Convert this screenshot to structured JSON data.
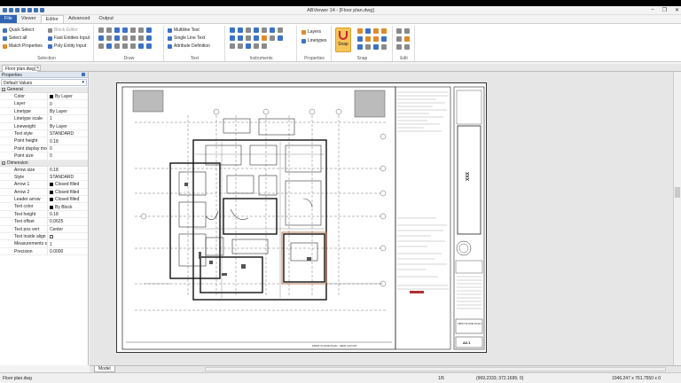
{
  "window": {
    "title": "ABViewer 14 - [Floor plan.dwg]",
    "controls": [
      "–",
      "❐",
      "✕"
    ]
  },
  "tabs": [
    "File",
    "Viewer",
    "Editor",
    "Advanced",
    "Output"
  ],
  "active_tab": "Editor",
  "ribbon": {
    "selection": {
      "label": "Selection",
      "quick_select": "Quick Select",
      "select_all": "Select all",
      "match_properties": "Match Properties",
      "block_editor": "Block Editor",
      "fast_entities_input": "Fast Entities Input",
      "poly_entity_input": "Poly Entity Input"
    },
    "draw": {
      "label": "Draw"
    },
    "text": {
      "label": "Text",
      "multiline_text": "Multiline Text",
      "single_line_text": "Single Line Text",
      "attribute_definition": "Attribute Definition"
    },
    "instruments": {
      "label": "Instruments"
    },
    "properties": {
      "label": "Properties",
      "layers": "Layers",
      "linetypes": "Linetypes"
    },
    "snap": {
      "label": "Snap",
      "snap_button": "Snap"
    },
    "edit": {
      "label": "Edit"
    }
  },
  "document_tab": "Floor plan.dwg",
  "properties_panel": {
    "title": "Properties",
    "dropdown": "Default Values",
    "general": {
      "title": "General",
      "rows": [
        {
          "k": "Color",
          "v": "By Layer",
          "swatch": "black"
        },
        {
          "k": "Layer",
          "v": "0"
        },
        {
          "k": "Linetype",
          "v": "By Layer"
        },
        {
          "k": "Linetype scale",
          "v": "1"
        },
        {
          "k": "Lineweight",
          "v": "By Layer"
        },
        {
          "k": "Text style",
          "v": "STANDARD"
        },
        {
          "k": "Point height",
          "v": "0.18"
        },
        {
          "k": "Point display mode",
          "v": "0"
        },
        {
          "k": "Point size",
          "v": "0"
        }
      ]
    },
    "dimension": {
      "title": "Dimension",
      "rows": [
        {
          "k": "Arrow size",
          "v": "0.18"
        },
        {
          "k": "Style",
          "v": "STANDARD"
        },
        {
          "k": "Arrow 1",
          "v": "Closed filled",
          "swatch": "black"
        },
        {
          "k": "Arrow 2",
          "v": "Closed filled",
          "swatch": "black"
        },
        {
          "k": "Leader arrow",
          "v": "Closed filled",
          "swatch": "black"
        },
        {
          "k": "Text color",
          "v": "By Block",
          "swatch": "black"
        },
        {
          "k": "Text height",
          "v": "0.18"
        },
        {
          "k": "Text offset",
          "v": "0.0625"
        },
        {
          "k": "Text pos vert",
          "v": "Center"
        },
        {
          "k": "Text inside align",
          "v": "",
          "swatch": "white"
        },
        {
          "k": "Measurements scale",
          "v": "1"
        },
        {
          "k": "Precision",
          "v": "0.0000"
        }
      ]
    }
  },
  "drawing": {
    "sheet_number": "A2.1",
    "title_block_label": "FIRST FLOOR PLAN",
    "footer_label": "FIRST FLOOR PLAN - NEW LAYOUT",
    "stamp": "XXX"
  },
  "model_tab": "Model",
  "status": {
    "file": "Floor plan.dwg",
    "page": "1/5",
    "cursor": "(969.2333; 372.1695; 0)",
    "size": "1046.247 x 761.7550 x 0"
  },
  "colors": {
    "accent": "#2f63b5",
    "snap": "#f6c458",
    "background": "#e6e6e6"
  }
}
